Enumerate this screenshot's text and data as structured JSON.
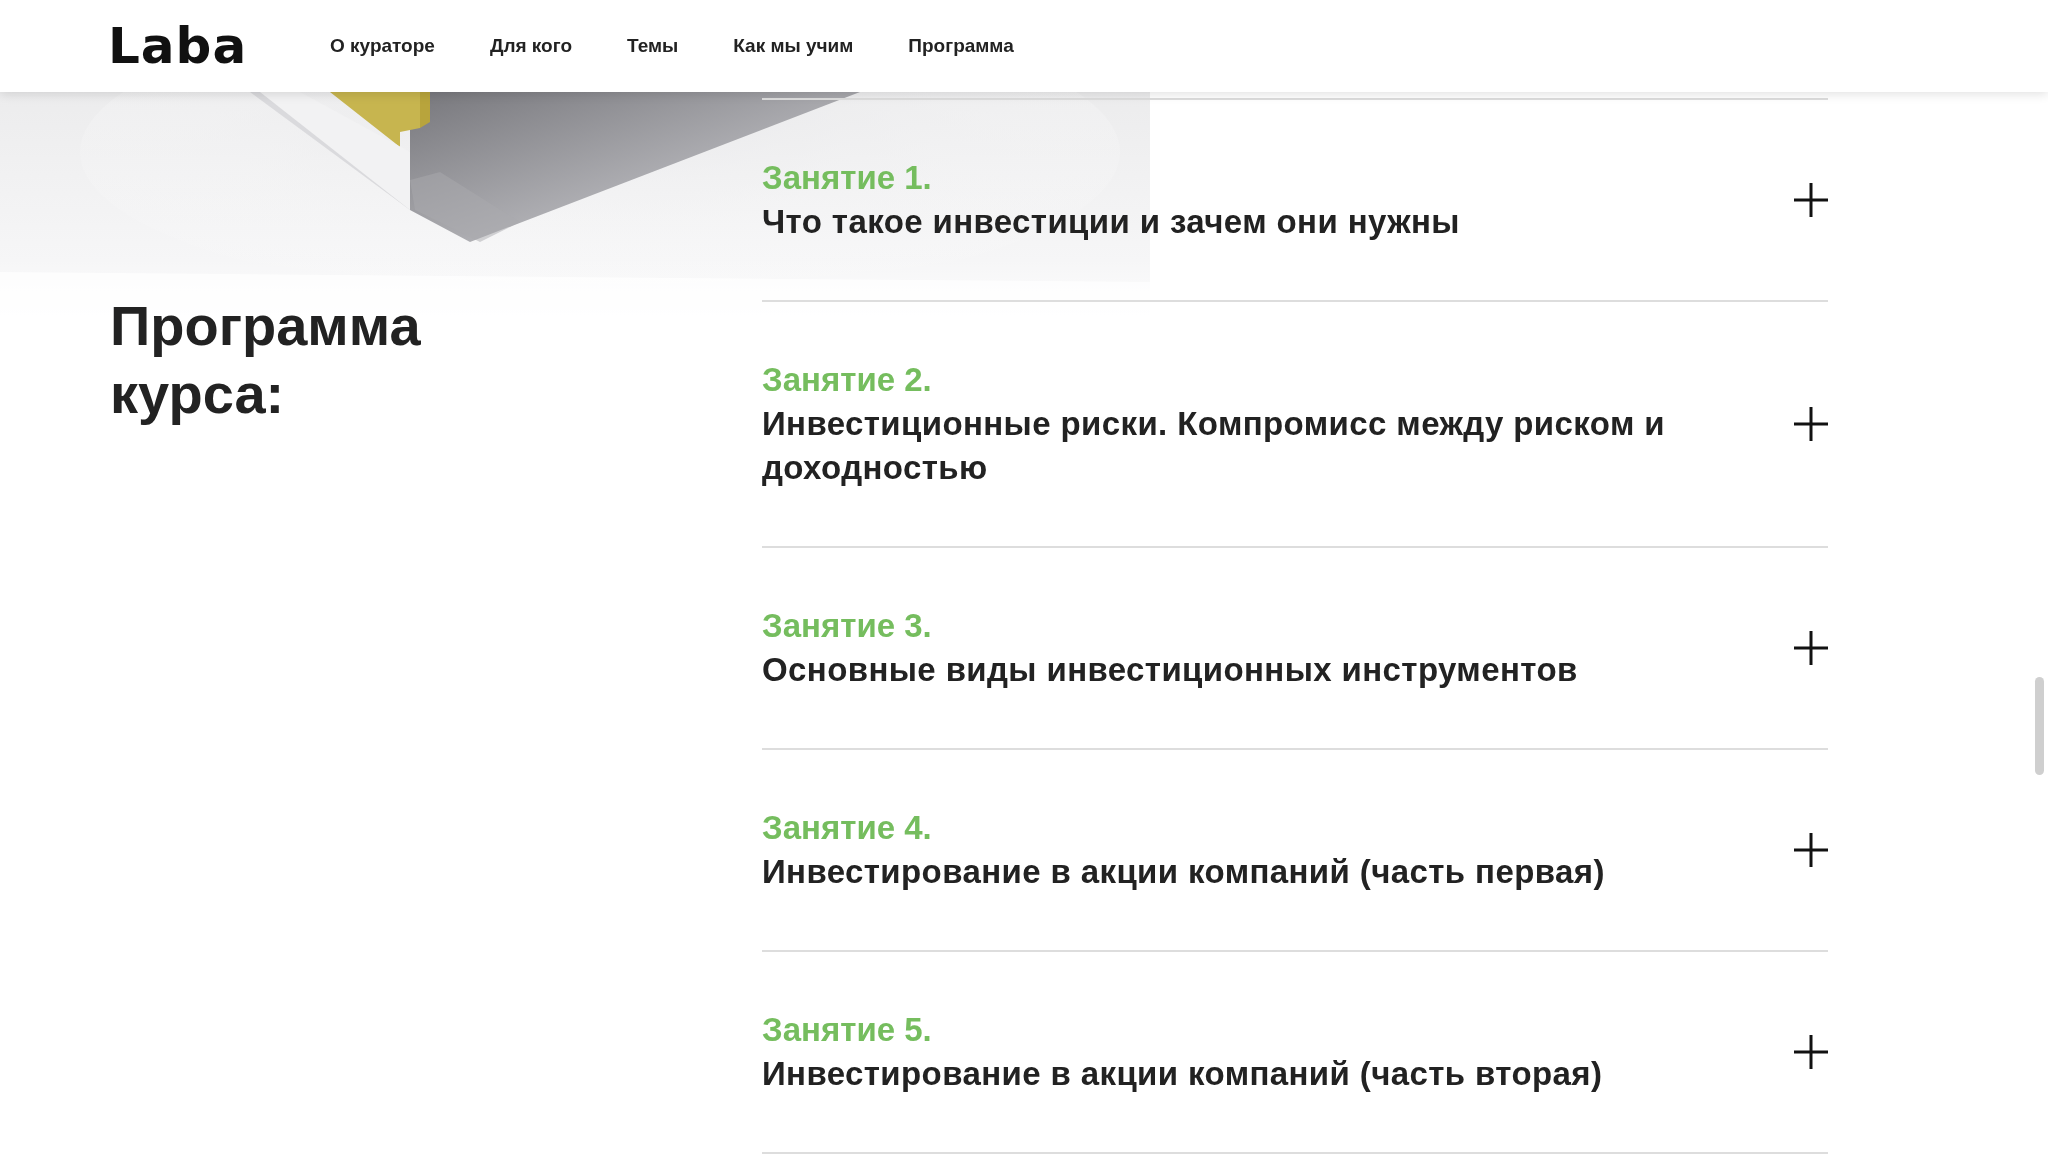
{
  "header": {
    "logo": "Laba",
    "nav": [
      "О кураторе",
      "Для кого",
      "Темы",
      "Как мы учим",
      "Программа"
    ]
  },
  "section": {
    "heading": "Программа курса:",
    "lessons": [
      {
        "number": "Занятие 1.",
        "title": "Что такое инвестиции и зачем они нужны",
        "expanded": false
      },
      {
        "number": "Занятие 2.",
        "title": "Инвестиционные риски. Компромисс между риском и доходностью",
        "expanded": false
      },
      {
        "number": "Занятие 3.",
        "title": "Основные виды инвестиционных инструментов",
        "expanded": false
      },
      {
        "number": "Занятие 4.",
        "title": "Инвестирование в акции компаний (часть первая)",
        "expanded": false
      },
      {
        "number": "Занятие 5.",
        "title": "Инвестирование в акции компаний (часть вторая)",
        "expanded": false
      }
    ]
  }
}
